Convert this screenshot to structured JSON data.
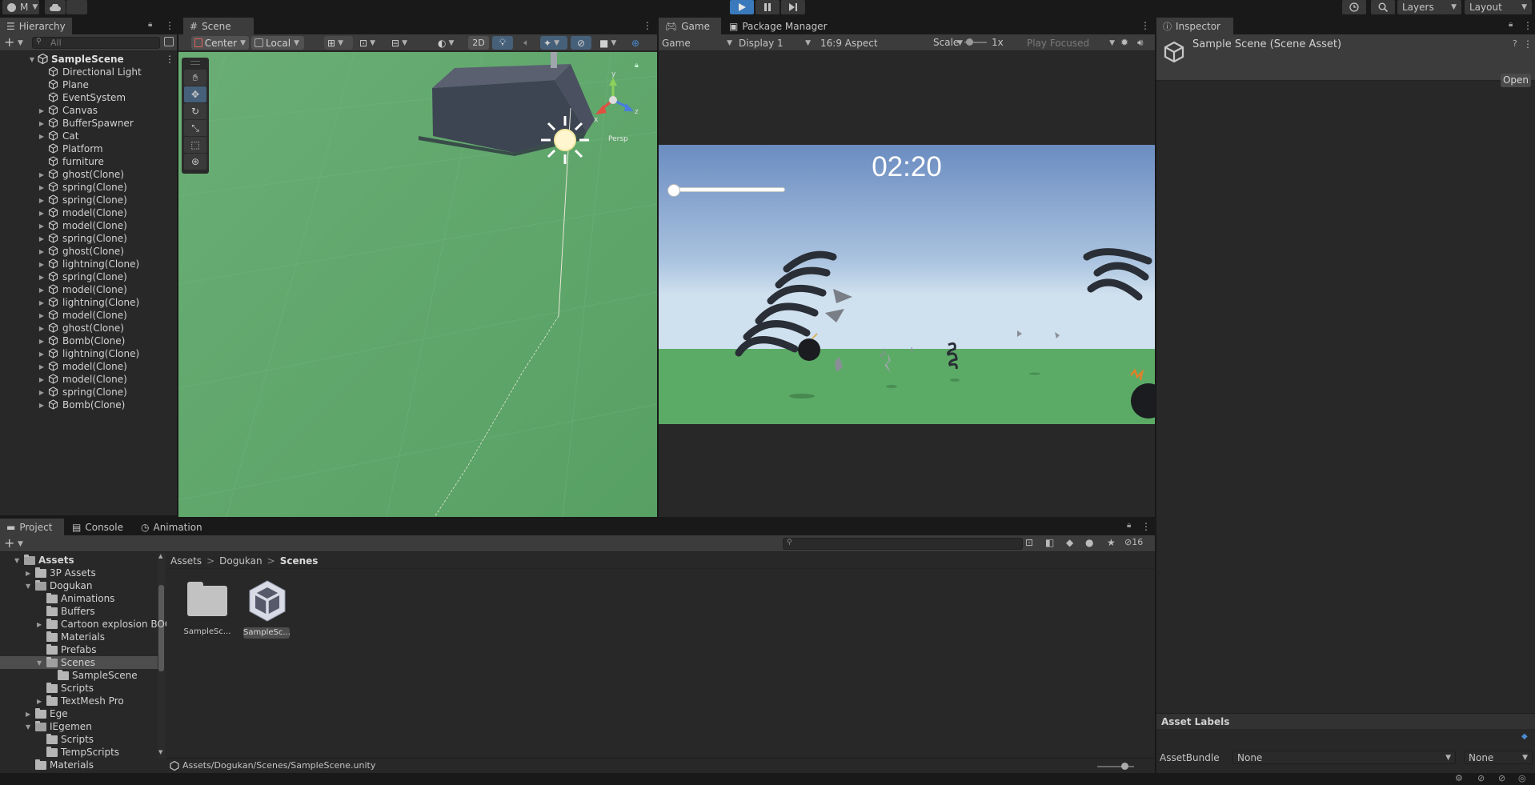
{
  "toolbar": {
    "account_label": "M",
    "layers_label": "Layers",
    "layout_label": "Layout"
  },
  "hierarchy": {
    "tab": "Hierarchy",
    "search_placeholder": "All",
    "scene": "SampleScene",
    "items": [
      {
        "label": "Directional Light",
        "foldable": false
      },
      {
        "label": "Plane",
        "foldable": false
      },
      {
        "label": "EventSystem",
        "foldable": false
      },
      {
        "label": "Canvas",
        "foldable": true
      },
      {
        "label": "BufferSpawner",
        "foldable": true
      },
      {
        "label": "Cat",
        "foldable": true
      },
      {
        "label": "Platform",
        "foldable": false
      },
      {
        "label": "furniture",
        "foldable": false
      },
      {
        "label": "ghost(Clone)",
        "foldable": true
      },
      {
        "label": "spring(Clone)",
        "foldable": true
      },
      {
        "label": "spring(Clone)",
        "foldable": true
      },
      {
        "label": "model(Clone)",
        "foldable": true
      },
      {
        "label": "model(Clone)",
        "foldable": true
      },
      {
        "label": "spring(Clone)",
        "foldable": true
      },
      {
        "label": "ghost(Clone)",
        "foldable": true
      },
      {
        "label": "lightning(Clone)",
        "foldable": true
      },
      {
        "label": "spring(Clone)",
        "foldable": true
      },
      {
        "label": "model(Clone)",
        "foldable": true
      },
      {
        "label": "lightning(Clone)",
        "foldable": true
      },
      {
        "label": "model(Clone)",
        "foldable": true
      },
      {
        "label": "ghost(Clone)",
        "foldable": true
      },
      {
        "label": "Bomb(Clone)",
        "foldable": true
      },
      {
        "label": "lightning(Clone)",
        "foldable": true
      },
      {
        "label": "model(Clone)",
        "foldable": true
      },
      {
        "label": "model(Clone)",
        "foldable": true
      },
      {
        "label": "spring(Clone)",
        "foldable": true
      },
      {
        "label": "Bomb(Clone)",
        "foldable": true
      }
    ]
  },
  "scene": {
    "tab": "Scene",
    "pivot": "Center",
    "space": "Local",
    "mode_2d": "2D",
    "gizmo_persp": "Persp",
    "tools": [
      "hand-tool-icon",
      "move-tool-icon",
      "rotate-tool-icon",
      "scale-tool-icon",
      "rect-tool-icon",
      "transform-tool-icon"
    ]
  },
  "game": {
    "tab": "Game",
    "tab2": "Package Manager",
    "view_select": "Game",
    "display": "Display 1",
    "aspect": "16:9 Aspect",
    "scale_label": "Scale",
    "scale_value": "1x",
    "play_mode": "Play Focused",
    "timer": "02:20",
    "slider_fraction": 0
  },
  "inspector": {
    "tab": "Inspector",
    "title": "Sample Scene (Scene Asset)",
    "open_button": "Open",
    "asset_labels": "Asset Labels",
    "asset_bundle_label": "AssetBundle",
    "asset_bundle_value": "None",
    "asset_variant_value": "None"
  },
  "project": {
    "tabs": [
      "Project",
      "Console",
      "Animation"
    ],
    "hidden_count": "16",
    "breadcrumb": [
      "Assets",
      "Dogukan",
      "Scenes"
    ],
    "tree": [
      {
        "label": "Assets",
        "indent": 0,
        "fold": "open",
        "bold": true
      },
      {
        "label": "3P Assets",
        "indent": 1,
        "fold": "closed"
      },
      {
        "label": "Dogukan",
        "indent": 1,
        "fold": "open"
      },
      {
        "label": "Animations",
        "indent": 2,
        "fold": "none"
      },
      {
        "label": "Buffers",
        "indent": 2,
        "fold": "none"
      },
      {
        "label": "Cartoon explosion BOOM",
        "indent": 2,
        "fold": "closed"
      },
      {
        "label": "Materials",
        "indent": 2,
        "fold": "none"
      },
      {
        "label": "Prefabs",
        "indent": 2,
        "fold": "none"
      },
      {
        "label": "Scenes",
        "indent": 2,
        "fold": "open",
        "selected": true
      },
      {
        "label": "SampleScene",
        "indent": 3,
        "fold": "none"
      },
      {
        "label": "Scripts",
        "indent": 2,
        "fold": "none"
      },
      {
        "label": "TextMesh Pro",
        "indent": 2,
        "fold": "closed"
      },
      {
        "label": "Ege",
        "indent": 1,
        "fold": "closed"
      },
      {
        "label": "IEgemen",
        "indent": 1,
        "fold": "open"
      },
      {
        "label": "Scripts",
        "indent": 2,
        "fold": "none"
      },
      {
        "label": "TempScripts",
        "indent": 2,
        "fold": "none"
      },
      {
        "label": "Materials",
        "indent": 1,
        "fold": "none"
      }
    ],
    "assets": [
      {
        "label": "SampleSc...",
        "kind": "folder"
      },
      {
        "label": "SampleSc...",
        "kind": "unity-scene"
      }
    ],
    "status_path": "Assets/Dogukan/Scenes/SampleScene.unity"
  },
  "colors": {
    "accent": "#3a79bb",
    "ground": "#5ba56a",
    "sky_top": "#6a8cc0",
    "selection": "#2c5d87"
  }
}
